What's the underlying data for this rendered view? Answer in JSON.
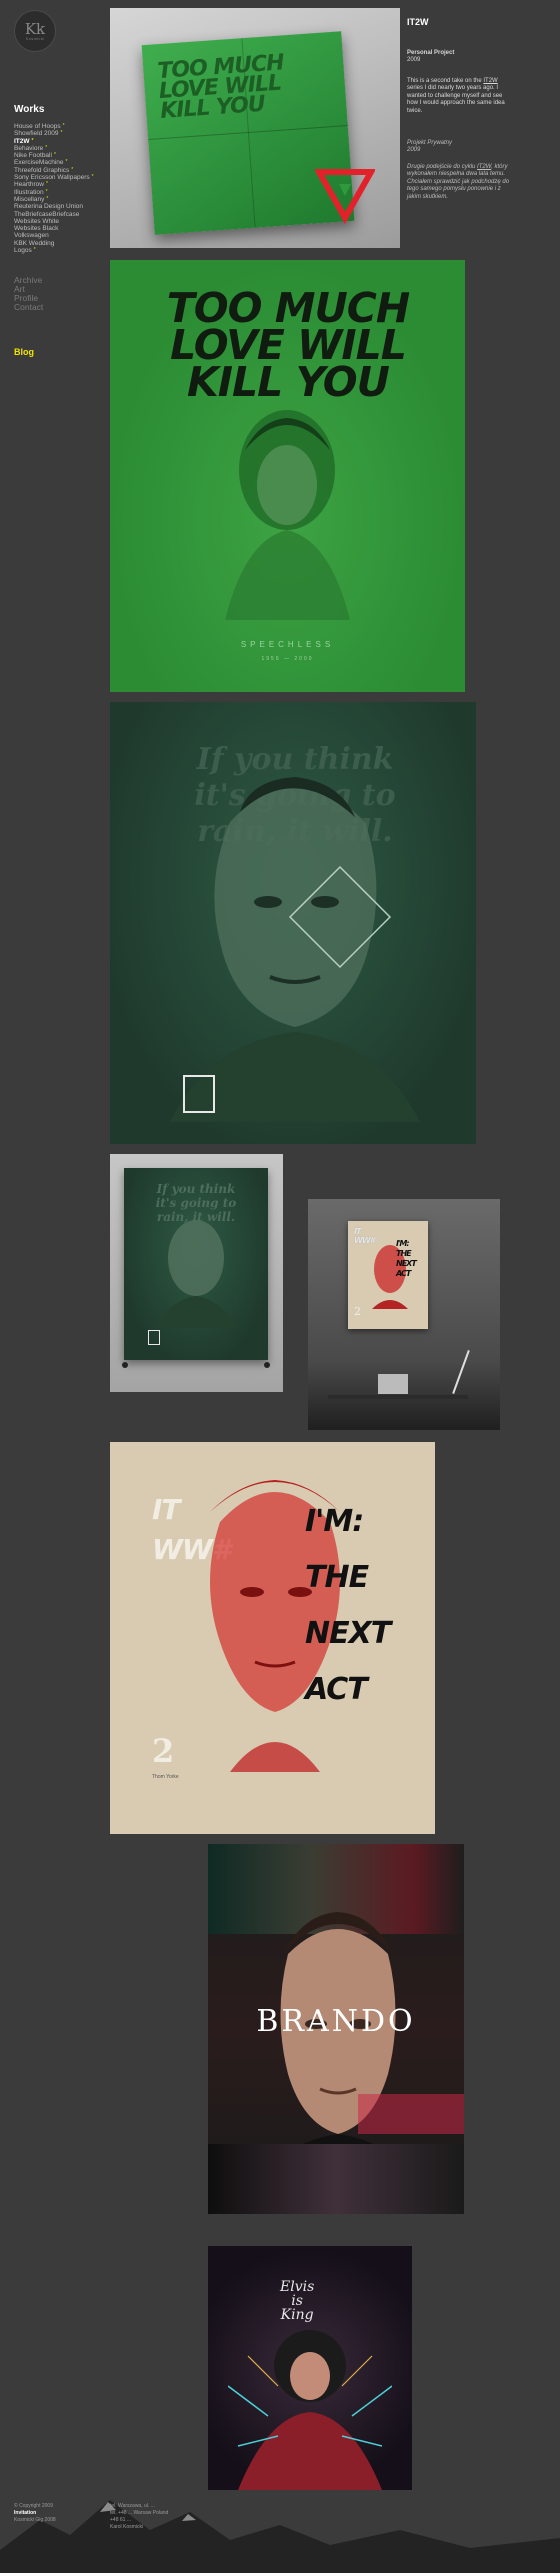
{
  "logo": {
    "mark": "Kk",
    "sub": "Kosmicki"
  },
  "sidebar": {
    "works_heading": "Works",
    "works": [
      {
        "label": "House of Hoops",
        "star": true
      },
      {
        "label": "Showfield 2009",
        "star": true
      },
      {
        "label": "IT2W",
        "star": true,
        "active": true
      },
      {
        "label": "Behaviore",
        "star": true
      },
      {
        "label": "Nike Football",
        "star": true
      },
      {
        "label": "ExerciseMachine",
        "star": true
      },
      {
        "label": "Threefold Graphics",
        "star": true
      },
      {
        "label": "Sony Ericsson Wallpapers",
        "star": true
      },
      {
        "label": "Hearthrow",
        "star": true
      },
      {
        "label": "Illustration",
        "star": true
      },
      {
        "label": "Miscellany",
        "star": true
      },
      {
        "label": "Reuterina Design Union",
        "star": false
      },
      {
        "label": "TheBriefcaseBriefcase",
        "star": false
      },
      {
        "label": "Websites White",
        "star": false
      },
      {
        "label": "Websites Black",
        "star": false
      },
      {
        "label": "Volkswagen",
        "star": false
      },
      {
        "label": "KBK Wedding",
        "star": false
      },
      {
        "label": "Logos",
        "star": true
      }
    ],
    "secondary": [
      "Archive",
      "Art",
      "Profile",
      "Contact"
    ],
    "blog": "Blog"
  },
  "project": {
    "title": "IT2W",
    "type": "Personal Project",
    "year": "2009",
    "desc_en_pre": "This is a second take on the ",
    "desc_en_link": "IT2W",
    "desc_en_post": " series I did nearly two years ago. I wanted to challenge myself and see how I would approach the same idea twice.",
    "pl_type": "Projekt Prywatny",
    "pl_year": "2009",
    "desc_pl_pre": "Drugie podejście do cyklu ",
    "desc_pl_link": "IT2W",
    "desc_pl_post": ", który wykonałem niespełna dwa lata temu. Chciałem sprawdzić jak podchodzę do tego samego pomysłu ponownie i z jakim skutkiem."
  },
  "artworks": {
    "poster1": {
      "headline": [
        "TOO MUCH",
        "LOVE WILL",
        "KILL YOU"
      ]
    },
    "poster2": {
      "headline": [
        "TOO MUCH",
        "LOVE WILL",
        "KILL YOU"
      ],
      "footer": "SPEECHLESS",
      "years": "1956 — 2009"
    },
    "poster3": {
      "gothic": [
        "If you think",
        "it's going to",
        "rain, it will."
      ]
    },
    "poster5": {
      "left": [
        "IT",
        "WW#"
      ],
      "right": [
        "I'M:",
        "THE",
        "NEXT",
        "ACT"
      ],
      "num": "2"
    },
    "poster6": {
      "left": [
        "IT",
        "WW#"
      ],
      "right": [
        "I'M:",
        "THE",
        "NEXT",
        "ACT"
      ],
      "num": "2",
      "credit": "Thom Yorke"
    },
    "poster7": {
      "name": "BRANDO"
    },
    "poster8": {
      "words": [
        "Elvis",
        "is",
        "King"
      ]
    }
  },
  "footer": {
    "col1": [
      "© Copyright 2009",
      "Invitation",
      "Kosmicki Gig 2008"
    ],
    "col2": [
      "tel. Warszawa, ul. ...",
      "tel. +48 ... Warsaw Poland",
      "+48 61 ...",
      "Karol Kosmicki"
    ]
  },
  "colors": {
    "background": "#3b3b3b",
    "accent_yellow": "#f2e600",
    "poster_green": "#2e9a3c",
    "poster_red": "#d62a2a"
  }
}
